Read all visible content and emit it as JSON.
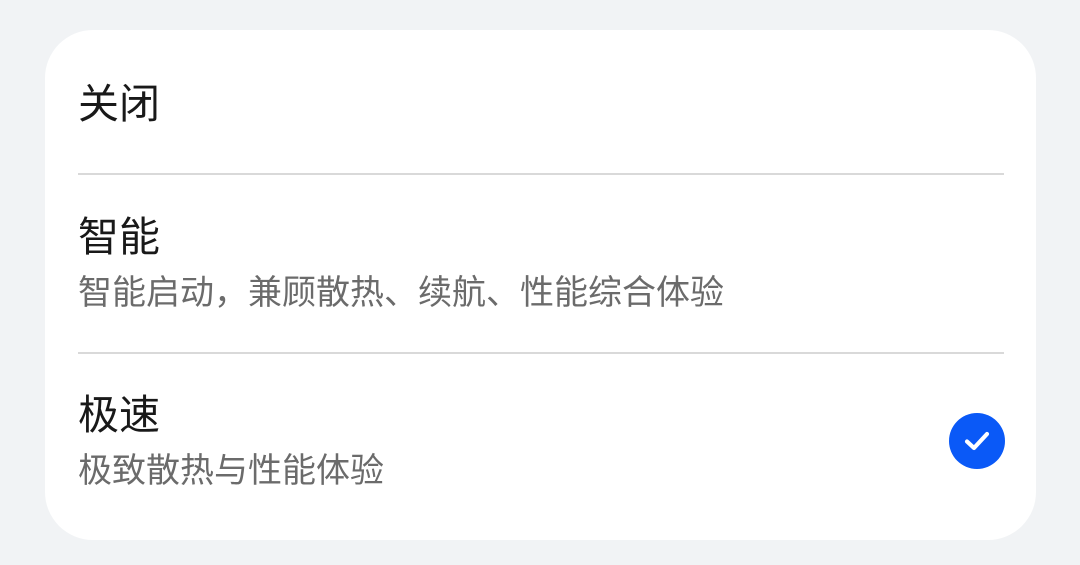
{
  "options": [
    {
      "title": "关闭",
      "description": ""
    },
    {
      "title": "智能",
      "description": "智能启动，兼顾散热、续航、性能综合体验"
    },
    {
      "title": "极速",
      "description": "极致散热与性能体验",
      "selected": true
    }
  ],
  "colors": {
    "accent": "#0a59f7",
    "background": "#f1f3f5",
    "card": "#ffffff",
    "title_text": "#191919",
    "description_text": "#6b6b6b",
    "divider": "#d9d9d9"
  },
  "icons": {
    "selected": "checkmark-circle-icon"
  }
}
